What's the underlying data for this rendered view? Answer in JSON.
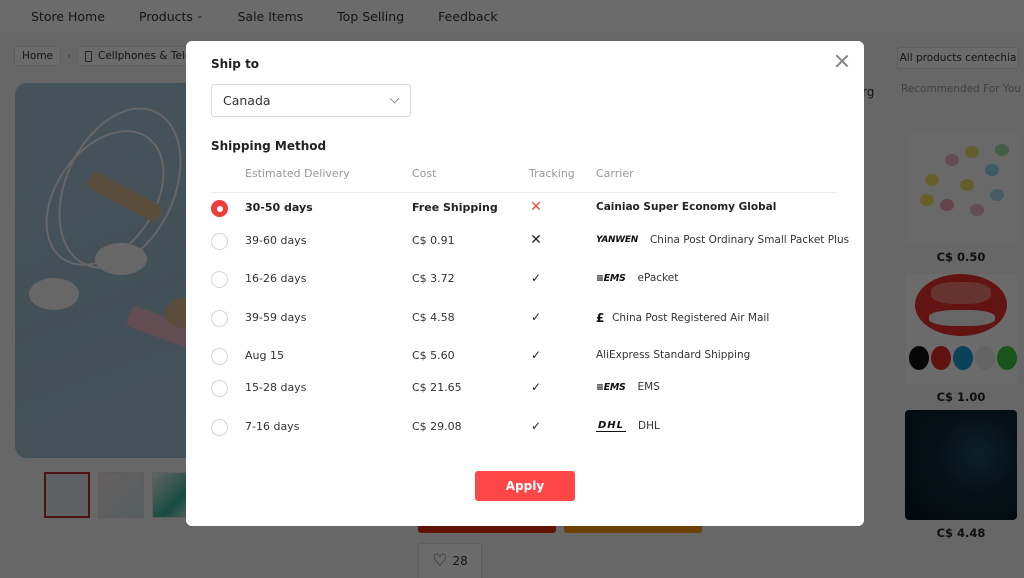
{
  "topnav": {
    "items": [
      {
        "label": "Store Home"
      },
      {
        "label": "Products",
        "has_dropdown": true
      },
      {
        "label": "Sale Items"
      },
      {
        "label": "Top Selling"
      },
      {
        "label": "Feedback"
      }
    ],
    "dropdown_glyph": "⌄"
  },
  "breadcrumb": {
    "home": "Home",
    "separator": "›",
    "category": "Cellphones & Telec",
    "category_icon": "phone-icon"
  },
  "store": {
    "all_products_label": "All products centechia",
    "partial_text": "rg"
  },
  "recommended": {
    "title": "Recommended For You",
    "items": [
      {
        "price": "C$ 0.50",
        "image": "cable-protector-bits"
      },
      {
        "price": "C$ 1.00",
        "image": "cable-winder-case"
      },
      {
        "price": "C$ 4.48",
        "image": "wireless-earbuds-charger"
      }
    ]
  },
  "product": {
    "wishlist_count": "28",
    "wishlist_icon": "♡",
    "thumbnails": 3,
    "active_thumbnail": 0
  },
  "modal": {
    "ship_to_label": "Ship to",
    "country": "Canada",
    "shipping_method_label": "Shipping Method",
    "columns": {
      "delivery": "Estimated Delivery",
      "cost": "Cost",
      "tracking": "Tracking",
      "carrier": "Carrier"
    },
    "options": [
      {
        "delivery": "30-50 days",
        "cost": "Free Shipping",
        "tracking": "none-highlight",
        "tracking_glyph": "✕",
        "carrier": "Cainiao Super Economy Global",
        "carrier_logo": "",
        "selected": true
      },
      {
        "delivery": "39-60 days",
        "cost": "C$ 0.91",
        "tracking": "none",
        "tracking_glyph": "✕",
        "carrier": "China Post Ordinary Small Packet Plus",
        "carrier_logo": "YANWEN",
        "selected": false
      },
      {
        "delivery": "16-26 days",
        "cost": "C$ 3.72",
        "tracking": "available",
        "tracking_glyph": "✓",
        "carrier": "ePacket",
        "carrier_logo": "≡EMS",
        "selected": false
      },
      {
        "delivery": "39-59 days",
        "cost": "C$ 4.58",
        "tracking": "available",
        "tracking_glyph": "✓",
        "carrier": "China Post Registered Air Mail",
        "carrier_logo": "£",
        "selected": false
      },
      {
        "delivery": "Aug 15",
        "cost": "C$ 5.60",
        "tracking": "available",
        "tracking_glyph": "✓",
        "carrier": "AliExpress Standard Shipping",
        "carrier_logo": "",
        "selected": false
      },
      {
        "delivery": "15-28 days",
        "cost": "C$ 21.65",
        "tracking": "available",
        "tracking_glyph": "✓",
        "carrier": "EMS",
        "carrier_logo": "≡EMS",
        "selected": false
      },
      {
        "delivery": "7-16 days",
        "cost": "C$ 29.08",
        "tracking": "available",
        "tracking_glyph": "✓",
        "carrier": "DHL",
        "carrier_logo": "DHL",
        "selected": false
      }
    ],
    "apply_label": "Apply",
    "accent_color": "#ff4747"
  }
}
